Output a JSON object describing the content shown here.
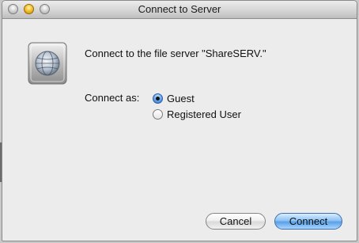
{
  "window": {
    "title": "Connect to Server"
  },
  "icons": {
    "server": "network-server-globe-icon"
  },
  "message": "Connect to the file server \"ShareSERV.\"",
  "connect_as": {
    "label": "Connect as:",
    "options": [
      {
        "label": "Guest",
        "selected": true
      },
      {
        "label": "Registered User",
        "selected": false
      }
    ]
  },
  "buttons": {
    "cancel": "Cancel",
    "connect": "Connect"
  },
  "colors": {
    "default_button": "#5aa0e6",
    "window_background": "#ececec"
  }
}
